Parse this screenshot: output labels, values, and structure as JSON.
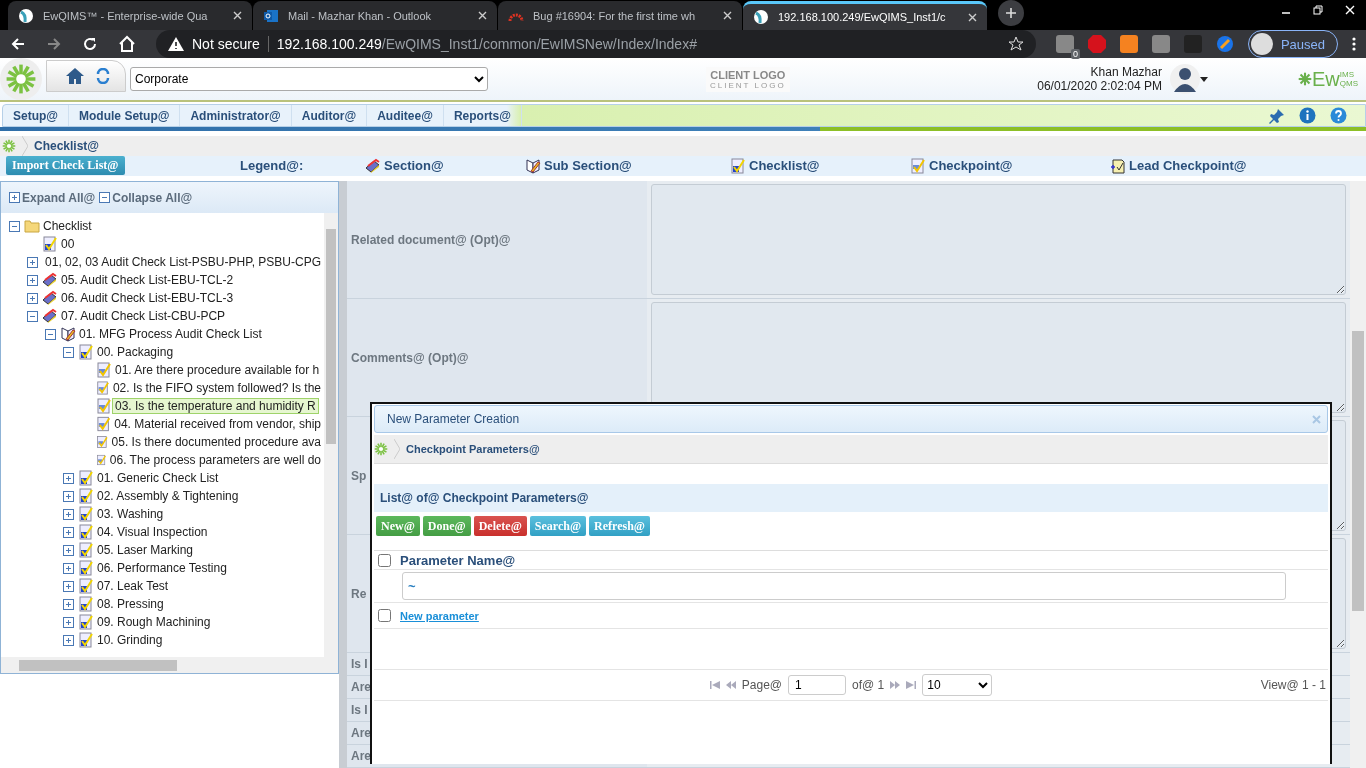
{
  "browser": {
    "tabs": [
      {
        "title": "EwQIMS™ - Enterprise-wide Qua",
        "selected": false
      },
      {
        "title": "Mail - Mazhar Khan - Outlook",
        "selected": false
      },
      {
        "title": "Bug #16904: For the first time wh",
        "selected": false
      },
      {
        "title": "192.168.100.249/EwQIMS_Inst1/c",
        "selected": true
      }
    ],
    "security": "Not secure",
    "url_host": "192.168.100.249",
    "url_path": "/EwQIMS_Inst1/common/EwIMSNew/Index/Index#",
    "badge_count": "0",
    "profile": "Paused"
  },
  "header": {
    "site": "Corporate",
    "client_logo": "CLIENT LOGO",
    "client_logo_sub": "CLIENT LOGO",
    "user": "Khan Mazhar",
    "datetime": "06/01/2020 2:02:04 PM",
    "logo_main": "Ew",
    "logo_top": "IMS",
    "logo_bottom": "QMS"
  },
  "menu": [
    {
      "label": "Setup@"
    },
    {
      "label": "Module Setup@"
    },
    {
      "label": "Administrator@"
    },
    {
      "label": "Auditor@"
    },
    {
      "label": "Auditee@"
    },
    {
      "label": "Reports@"
    }
  ],
  "breadcrumb": "Checklist@",
  "legend": {
    "import_button": "Import Check List@",
    "title": "Legend@:",
    "items": [
      {
        "kind": "section",
        "label": "Section@"
      },
      {
        "kind": "subsection",
        "label": "Sub Section@"
      },
      {
        "kind": "checklist",
        "label": "Checklist@"
      },
      {
        "kind": "checkpoint",
        "label": "Checkpoint@"
      },
      {
        "kind": "lead",
        "label": "Lead Checkpoint@"
      }
    ]
  },
  "tree_panel": {
    "expand_all": "Expand All@",
    "collapse_all": "Collapse All@",
    "tree": [
      {
        "kind": "folder",
        "label": "Checklist",
        "expanded": true,
        "selected": false,
        "children": [
          {
            "kind": "checklist",
            "label": "00",
            "selected": false
          },
          {
            "kind": "section",
            "label": "01, 02, 03 Audit Check List-PSBU-PHP, PSBU-CPG",
            "expanded": false,
            "selected": false
          },
          {
            "kind": "section",
            "label": "05. Audit Check List-EBU-TCL-2",
            "expanded": false,
            "selected": false
          },
          {
            "kind": "section",
            "label": "06. Audit Check List-EBU-TCL-3",
            "expanded": false,
            "selected": false
          },
          {
            "kind": "section",
            "label": "07. Audit Check List-CBU-PCP",
            "expanded": true,
            "selected": false,
            "children": [
              {
                "kind": "subsection",
                "label": "01. MFG Process Audit Check List",
                "expanded": true,
                "selected": false,
                "children": [
                  {
                    "kind": "checklist",
                    "label": "00. Packaging",
                    "expanded": true,
                    "selected": false,
                    "children": [
                      {
                        "kind": "checkpoint",
                        "label": "01. Are there procedure available for h",
                        "selected": false
                      },
                      {
                        "kind": "checkpoint",
                        "label": "02. Is the FIFO system followed? Is the",
                        "selected": false
                      },
                      {
                        "kind": "checkpoint",
                        "label": "03. Is the temperature and humidity R",
                        "selected": true
                      },
                      {
                        "kind": "checkpoint",
                        "label": "04. Material received from vendor, ship",
                        "selected": false
                      },
                      {
                        "kind": "checkpoint",
                        "label": "05. Is there documented procedure ava",
                        "selected": false
                      },
                      {
                        "kind": "checkpoint",
                        "label": "06. The process parameters are well do",
                        "selected": false
                      }
                    ]
                  },
                  {
                    "kind": "checklist",
                    "label": "01. Generic Check List",
                    "expanded": false,
                    "selected": false
                  },
                  {
                    "kind": "checklist",
                    "label": "02. Assembly & Tightening",
                    "expanded": false,
                    "selected": false
                  },
                  {
                    "kind": "checklist",
                    "label": "03. Washing",
                    "expanded": false,
                    "selected": false
                  },
                  {
                    "kind": "checklist",
                    "label": "04. Visual Inspection",
                    "expanded": false,
                    "selected": false
                  },
                  {
                    "kind": "checklist",
                    "label": "05. Laser Marking",
                    "expanded": false,
                    "selected": false
                  },
                  {
                    "kind": "checklist",
                    "label": "06. Performance Testing",
                    "expanded": false,
                    "selected": false
                  },
                  {
                    "kind": "checklist",
                    "label": "07. Leak Test",
                    "expanded": false,
                    "selected": false
                  },
                  {
                    "kind": "checklist",
                    "label": "08. Pressing",
                    "expanded": false,
                    "selected": false
                  },
                  {
                    "kind": "checklist",
                    "label": "09. Rough Machining",
                    "expanded": false,
                    "selected": false
                  },
                  {
                    "kind": "checklist",
                    "label": "10. Grinding",
                    "expanded": false,
                    "selected": false
                  }
                ]
              }
            ]
          }
        ]
      }
    ]
  },
  "form_rows": [
    {
      "kind": "textarea",
      "label": "Related document@ (Opt)@"
    },
    {
      "kind": "textarea",
      "label": "Comments@ (Opt)@"
    },
    {
      "kind": "textarea",
      "label": "Sp"
    },
    {
      "kind": "textarea",
      "label": "Re"
    },
    {
      "kind": "short",
      "label": "Is I"
    },
    {
      "kind": "short",
      "label": "Are"
    },
    {
      "kind": "short",
      "label": "Is I"
    },
    {
      "kind": "short",
      "label": "Are"
    },
    {
      "kind": "short",
      "label": "Are"
    }
  ],
  "dialog": {
    "title": "New Parameter Creation",
    "breadcrumb": "Checkpoint Parameters@",
    "list_title": "List@ of@ Checkpoint Parameters@",
    "buttons": [
      {
        "label": "New@",
        "kind": "success"
      },
      {
        "label": "Done@",
        "kind": "success"
      },
      {
        "label": "Delete@",
        "kind": "danger"
      },
      {
        "label": "Search@",
        "kind": "info"
      },
      {
        "label": "Refresh@",
        "kind": "info"
      }
    ],
    "column": "Parameter Name@",
    "header_checked": false,
    "filter_value": "~",
    "rows": [
      {
        "name": "New parameter",
        "checked": false
      }
    ],
    "pager": {
      "page_label": "Page@",
      "page": "1",
      "of_label": "of@ 1",
      "page_size": "10",
      "view": "View@ 1 - 1"
    }
  }
}
